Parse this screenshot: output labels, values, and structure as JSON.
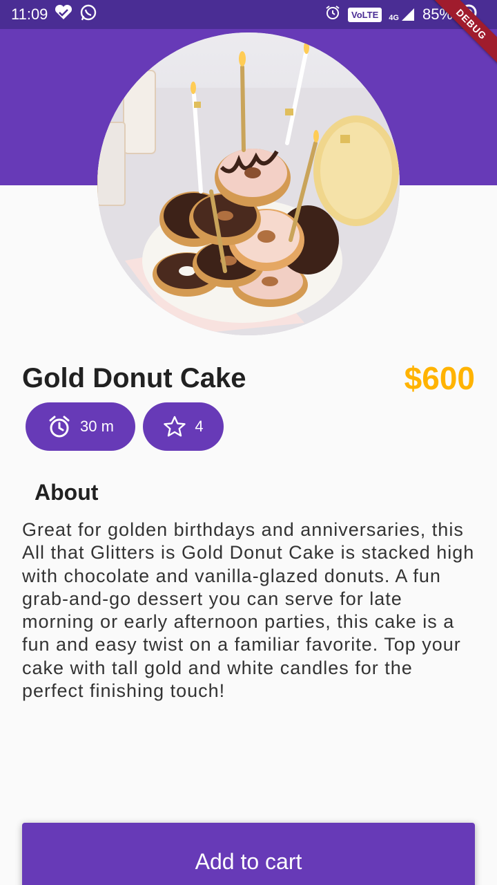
{
  "status_bar": {
    "time": "11:09",
    "volte": "VoLTE",
    "network": "4G",
    "battery": "85%"
  },
  "debug_banner": "DEBUG",
  "product": {
    "name": "Gold Donut Cake",
    "price": "$600",
    "time": "30 m",
    "rating": "4",
    "image_icon": "donut-cake-photo"
  },
  "about": {
    "heading": "About",
    "text": "Great for golden birthdays and anniversaries, this All that Glitters is Gold Donut Cake is stacked high with chocolate and vanilla-glazed donuts. A fun grab-and-go dessert you can serve for late morning or early afternoon parties, this cake is a fun and easy twist on a familiar favorite. Top your cake with tall gold and white candles for the perfect finishing touch!"
  },
  "actions": {
    "add_to_cart": "Add to cart"
  },
  "colors": {
    "primary": "#673ab7",
    "status_bar": "#4a2d94",
    "price": "#ffb300",
    "debug": "#a01c2d"
  }
}
